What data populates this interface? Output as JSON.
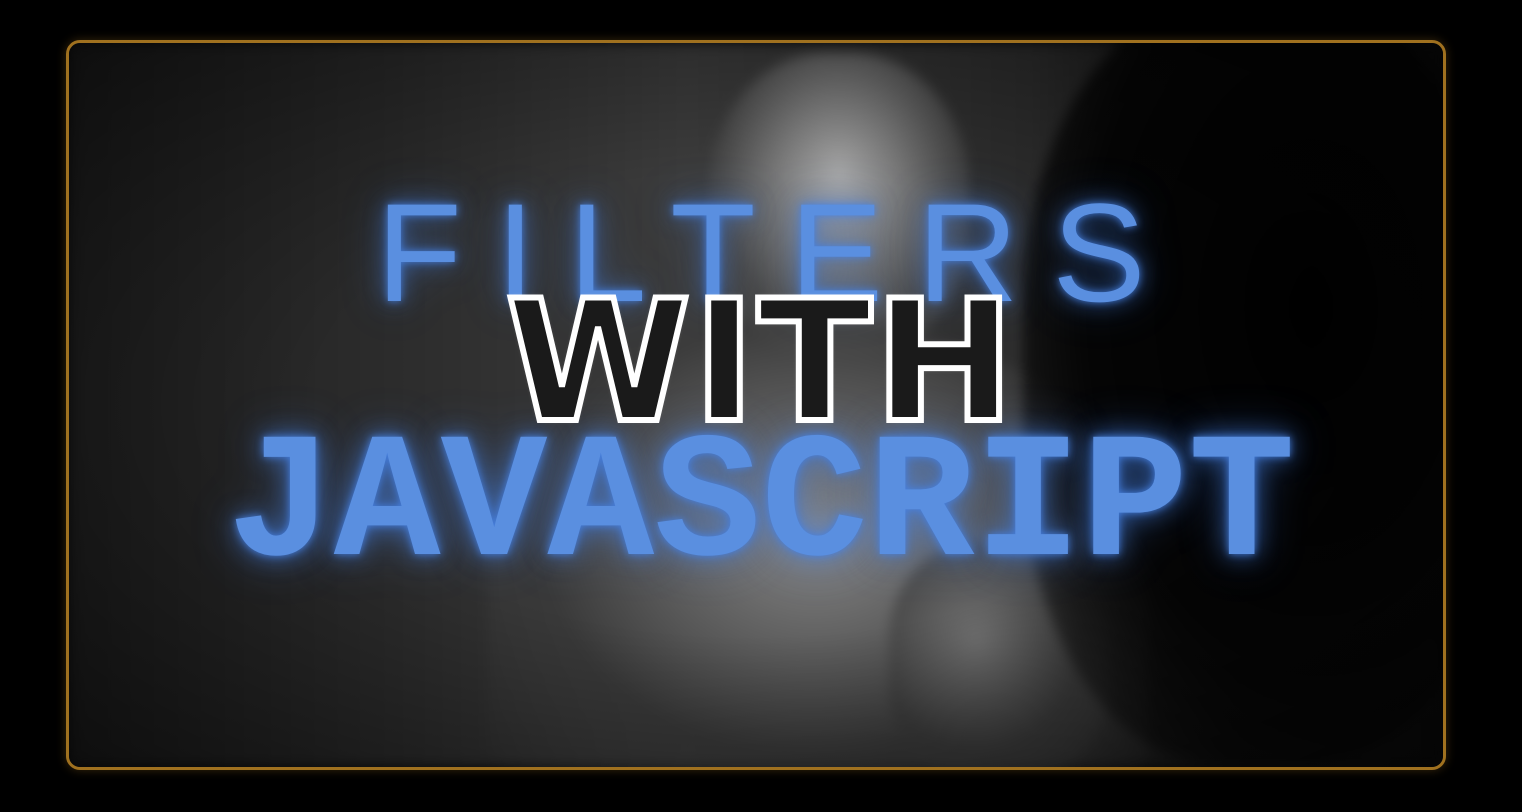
{
  "title": {
    "line1": "FILTERS",
    "line2": "WITH",
    "line3": "JAVASCRIPT"
  },
  "colors": {
    "background": "#000000",
    "frame_border": "#a0711f",
    "neon_blue": "#5a8fe0",
    "outline_white": "#ffffff"
  }
}
